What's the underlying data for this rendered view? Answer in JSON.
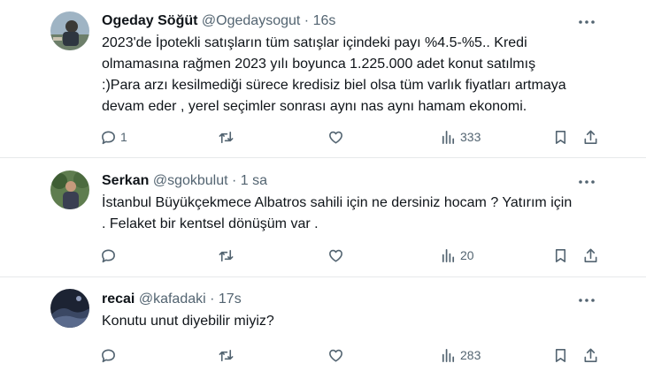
{
  "posts": [
    {
      "name": "Ogeday Söğüt",
      "handle": "@Ogedaysogut",
      "separator": "·",
      "time": "16s",
      "lines": [
        "2023'de İpotekli satışların tüm satışlar içindeki payı %4.5-%5.. Kredi",
        "olmamasına rağmen 2023 yılı boyunca 1.225.000 adet konut satılmış",
        ":)Para arzı kesilmediği sürece kredisiz biel olsa tüm varlık fiyatları artmaya",
        "devam eder , yerel seçimler sonrası aynı nas aynı hamam ekonomi."
      ],
      "replies": "1",
      "views": "333"
    },
    {
      "name": "Serkan",
      "handle": "@sgokbulut",
      "separator": "·",
      "time": "1 sa",
      "lines": [
        "İstanbul Büyükçekmece Albatros sahili için ne dersiniz hocam ? Yatırım için",
        ". Felaket bir kentsel dönüşüm var ."
      ],
      "replies": "",
      "views": "20"
    },
    {
      "name": "recai",
      "handle": "@kafadaki",
      "separator": "·",
      "time": "17s",
      "lines": [
        "Konutu unut diyebilir miyiz?"
      ],
      "replies": "",
      "views": "283"
    }
  ],
  "icons": {
    "reply": "reply-icon",
    "retweet": "retweet-icon",
    "like": "heart-icon",
    "views": "views-icon",
    "bookmark": "bookmark-icon",
    "share": "share-icon",
    "more": "more-icon"
  },
  "colors": {
    "text": "#0f1419",
    "secondary": "#536471",
    "divider": "#e7e9ea"
  }
}
